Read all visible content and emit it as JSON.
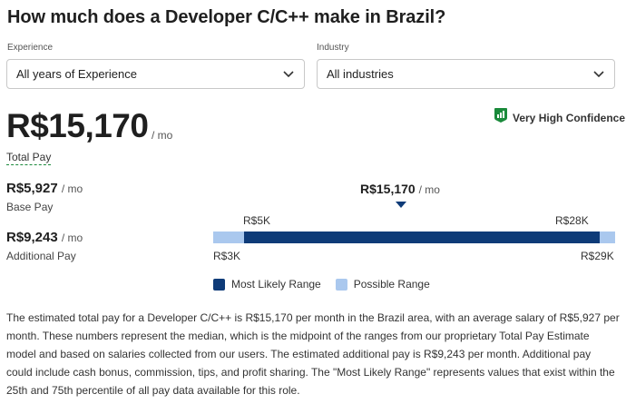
{
  "page": {
    "title": "How much does a Developer C/C++ make in Brazil?"
  },
  "filters": {
    "experience": {
      "label": "Experience",
      "value": "All years of Experience"
    },
    "industry": {
      "label": "Industry",
      "value": "All industries"
    }
  },
  "total_pay": {
    "amount": "R$15,170",
    "period": "/ mo",
    "label": "Total Pay"
  },
  "confidence": {
    "text": "Very High Confidence",
    "icon": "confidence-bars-icon",
    "color": "#1a8a3b"
  },
  "base_pay": {
    "amount": "R$5,927",
    "period": "/ mo",
    "label": "Base Pay"
  },
  "additional_pay": {
    "amount": "R$9,243",
    "period": "/ mo",
    "label": "Additional Pay"
  },
  "range": {
    "median_label": "R$15,170",
    "median_period": "/ mo",
    "likely_low_label": "R$5K",
    "likely_high_label": "R$28K",
    "possible_low_label": "R$3K",
    "possible_high_label": "R$29K",
    "possible_min": 3000,
    "likely_min": 5000,
    "median": 15170,
    "likely_max": 28000,
    "possible_max": 29000,
    "colors": {
      "likely": "#0e3b78",
      "possible": "#aac8ee"
    }
  },
  "legend": {
    "most_likely": "Most Likely Range",
    "possible": "Possible Range"
  },
  "description": "The estimated total pay for a Developer C/C++ is R$15,170 per month in the Brazil area, with an average salary of R$5,927 per month. These numbers represent the median, which is the midpoint of the ranges from our proprietary Total Pay Estimate model and based on salaries collected from our users. The estimated additional pay is R$9,243 per month. Additional pay could include cash bonus, commission, tips, and profit sharing. The \"Most Likely Range\" represents values that exist within the 25th and 75th percentile of all pay data available for this role."
}
